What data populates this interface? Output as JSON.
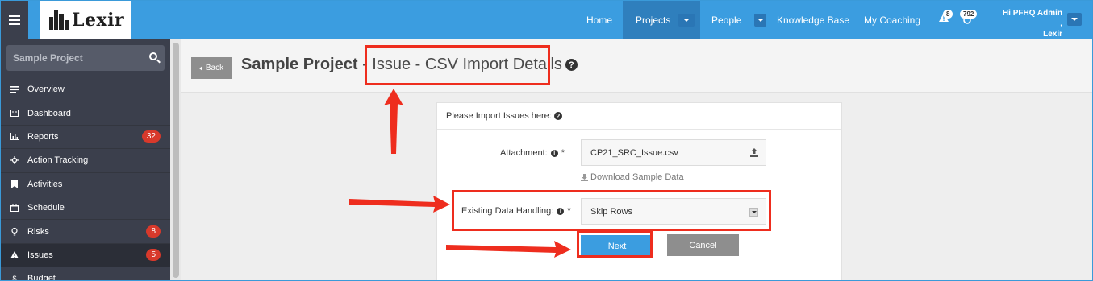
{
  "topbar": {
    "logo_text": "Lexir",
    "nav": [
      {
        "label": "Home"
      },
      {
        "label": "Projects"
      },
      {
        "label": "People"
      },
      {
        "label": "Knowledge Base"
      },
      {
        "label": "My Coaching"
      }
    ],
    "alerts_count": "8",
    "updates_count": "792",
    "greeting_line1": "Hi PFHQ Admin ,",
    "greeting_line2": "Lexir"
  },
  "sidebar": {
    "search_placeholder": "Sample Project",
    "items": [
      {
        "label": "Overview",
        "icon": "list-icon",
        "badge": ""
      },
      {
        "label": "Dashboard",
        "icon": "dashboard-icon",
        "badge": ""
      },
      {
        "label": "Reports",
        "icon": "bar-chart-icon",
        "badge": "32"
      },
      {
        "label": "Action Tracking",
        "icon": "crosshair-icon",
        "badge": ""
      },
      {
        "label": "Activities",
        "icon": "bookmark-icon",
        "badge": ""
      },
      {
        "label": "Schedule",
        "icon": "calendar-icon",
        "badge": ""
      },
      {
        "label": "Risks",
        "icon": "lightbulb-icon",
        "badge": "8"
      },
      {
        "label": "Issues",
        "icon": "warning-icon",
        "badge": "5"
      },
      {
        "label": "Budget",
        "icon": "dollar-icon",
        "badge": ""
      }
    ]
  },
  "header": {
    "back_label": "Back",
    "title_project": "Sample Project",
    "title_separator": " - ",
    "title_page": "Issue - CSV Import Details"
  },
  "form": {
    "heading": "Please Import Issues here:",
    "attachment_label": "Attachment:",
    "required_mark": "*",
    "attachment_value": "CP21_SRC_Issue.csv",
    "download_link": "Download Sample Data",
    "handling_label": "Existing Data Handling:",
    "handling_value": "Skip Rows",
    "next_label": "Next",
    "cancel_label": "Cancel"
  },
  "colors": {
    "accent": "#3b9de0",
    "sidebar_bg": "#3b3f4c",
    "badge_red": "#d8392b",
    "annotation_red": "#ee2d1e"
  }
}
